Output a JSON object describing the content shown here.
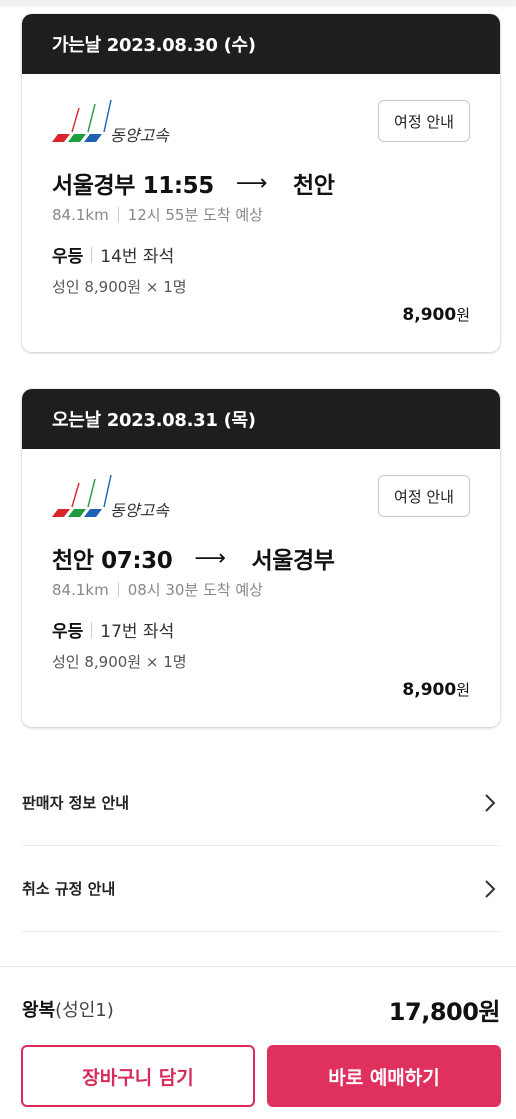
{
  "outbound": {
    "header": "가는날 2023.08.30 (수)",
    "company": "동양고속",
    "guide_label": "여정 안내",
    "from_time": "서울경부 11:55",
    "arrow": "⟶",
    "to": "천안",
    "distance": "84.1km",
    "arrival": "12시 55분 도착 예상",
    "grade": "우등",
    "seat": "14번 좌석",
    "fare": "성인 8,900원 × 1명",
    "price": "8,900",
    "price_unit": "원"
  },
  "inbound": {
    "header": "오는날 2023.08.31 (목)",
    "company": "동양고속",
    "guide_label": "여정 안내",
    "from_time": "천안 07:30",
    "arrow": "⟶",
    "to": "서울경부",
    "distance": "84.1km",
    "arrival": "08시 30분 도착 예상",
    "grade": "우등",
    "seat": "17번 좌석",
    "fare": "성인 8,900원 × 1명",
    "price": "8,900",
    "price_unit": "원"
  },
  "info_rows": [
    {
      "label": "판매자 정보 안내",
      "icon": "chevron-right-icon"
    },
    {
      "label": "취소 규정 안내",
      "icon": "chevron-right-icon"
    }
  ],
  "summary": {
    "trip_type": "왕복",
    "passengers": "(성인1)",
    "total": "17,800원"
  },
  "actions": {
    "cart_label": "장바구니 담기",
    "book_label": "바로 예매하기"
  },
  "colors": {
    "accent": "#e0305e",
    "header_bg": "#1e1e1e"
  }
}
